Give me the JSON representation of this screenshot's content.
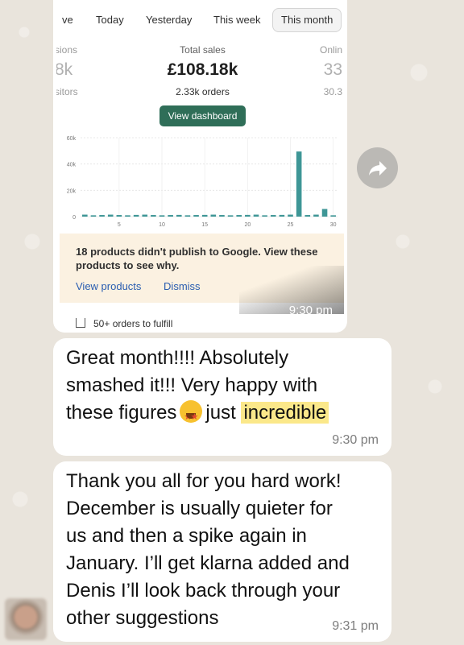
{
  "screenshot": {
    "tabs": [
      {
        "label": "ve",
        "active": false
      },
      {
        "label": "Today",
        "active": false
      },
      {
        "label": "Yesterday",
        "active": false
      },
      {
        "label": "This week",
        "active": false
      },
      {
        "label": "This month",
        "active": true
      }
    ],
    "metrics": {
      "left": {
        "label": "sions",
        "value": "8k",
        "sub": "sitors"
      },
      "center": {
        "label": "Total sales",
        "value": "£108.18k",
        "sub": "2.33k orders"
      },
      "right": {
        "label": "Onlin",
        "value": "33",
        "sub": "30.3"
      }
    },
    "dashboard_button": "View dashboard",
    "banner": {
      "text": "18 products didn't publish to Google. View these products to see why.",
      "view_link": "View products",
      "dismiss_link": "Dismiss"
    },
    "time": "9:30 pm",
    "fulfill_text": "50+ orders to fulfill"
  },
  "chart_data": {
    "type": "bar",
    "x": [
      1,
      2,
      3,
      4,
      5,
      6,
      7,
      8,
      9,
      10,
      11,
      12,
      13,
      14,
      15,
      16,
      17,
      18,
      19,
      20,
      21,
      22,
      23,
      24,
      25,
      26,
      27,
      28,
      29,
      30
    ],
    "values": [
      1500,
      1000,
      1200,
      1500,
      1200,
      1000,
      1300,
      1500,
      1200,
      1000,
      1200,
      1300,
      1000,
      1200,
      1300,
      1500,
      1200,
      1000,
      1200,
      1300,
      1500,
      1000,
      1200,
      1300,
      1500,
      49500,
      1200,
      1500,
      5800,
      1000
    ],
    "xticks": [
      "5",
      "10",
      "15",
      "20",
      "25",
      "30"
    ],
    "yticks": [
      "0",
      "20k",
      "40k",
      "60k"
    ],
    "ylim": [
      0,
      60000
    ],
    "color": "#3e9696"
  },
  "messages": [
    {
      "parts": [
        "Great month!!!! Absolutely",
        "smashed it!!! Very happy with",
        "these figures",
        "just",
        "incredible"
      ],
      "emoji": "star-struck-emoji",
      "time": "9:30 pm"
    },
    {
      "lines": [
        "Thank you all for you hard work!",
        "December is usually quieter for",
        "us and then a spike again in",
        "January. I’ll get klarna added and",
        "Denis I’ll look back through your",
        "other suggestions"
      ],
      "time": "9:31 pm"
    }
  ],
  "colors": {
    "accent": "#2f6e58",
    "highlight": "#fbe88a",
    "chart": "#3e9696"
  }
}
